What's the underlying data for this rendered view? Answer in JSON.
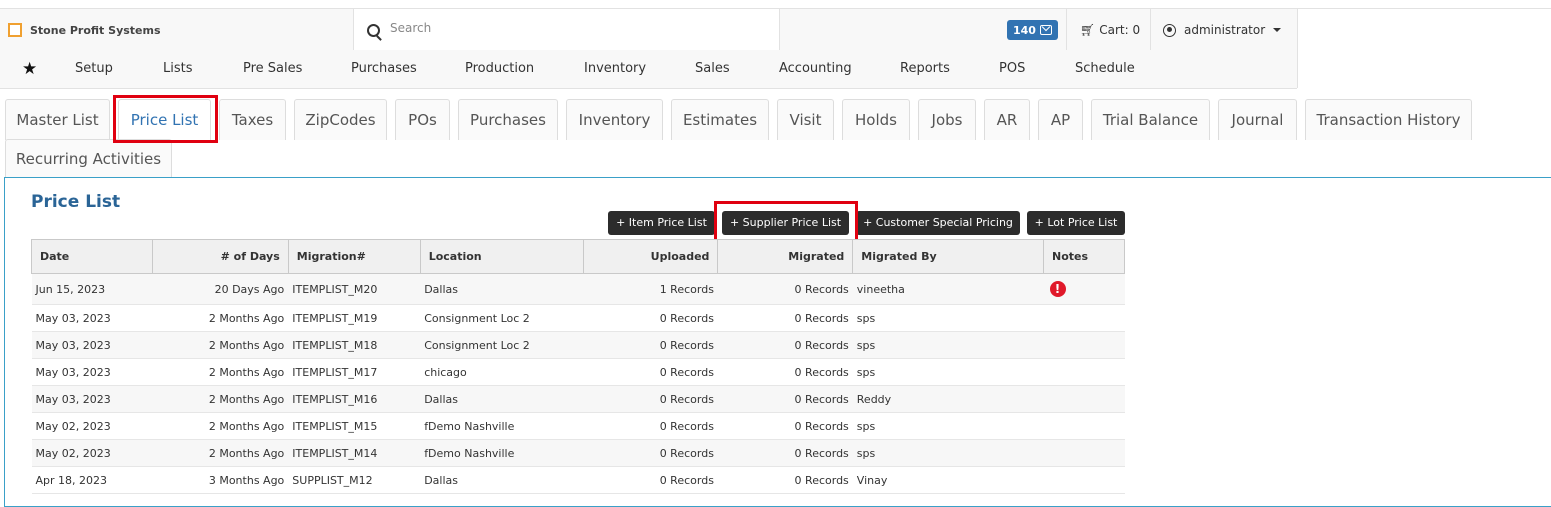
{
  "app": {
    "brand": "Stone Profit Systems",
    "search_placeholder": "Search",
    "notifications_count": "140",
    "cart_label": "Cart: 0",
    "user_name": "administrator"
  },
  "menu": [
    "Setup",
    "Lists",
    "Pre Sales",
    "Purchases",
    "Production",
    "Inventory",
    "Sales",
    "Accounting",
    "Reports",
    "POS",
    "Schedule"
  ],
  "tabs": [
    "Master List",
    "Price List",
    "Taxes",
    "ZipCodes",
    "POs",
    "Purchases",
    "Inventory",
    "Estimates",
    "Visit",
    "Holds",
    "Jobs",
    "AR",
    "AP",
    "Trial Balance",
    "Journal",
    "Transaction History",
    "Recurring Activities"
  ],
  "active_tab": "Price List",
  "page": {
    "title": "Price List",
    "buttons": [
      "+ Item Price List",
      "+ Supplier Price List",
      "+ Customer Special Pricing",
      "+ Lot Price List"
    ]
  },
  "table": {
    "headers": [
      "Date",
      "# of Days",
      "Migration#",
      "Location",
      "Uploaded",
      "Migrated",
      "Migrated By",
      "Notes"
    ],
    "rows": [
      [
        "Jun 15, 2023",
        "20 Days Ago",
        "ITEMPLIST_M20",
        "Dallas",
        "1 Records",
        "0 Records",
        "vineetha",
        "!"
      ],
      [
        "May 03, 2023",
        "2 Months Ago",
        "ITEMPLIST_M19",
        "Consignment Loc 2",
        "0 Records",
        "0 Records",
        "sps",
        ""
      ],
      [
        "May 03, 2023",
        "2 Months Ago",
        "ITEMPLIST_M18",
        "Consignment Loc 2",
        "0 Records",
        "0 Records",
        "sps",
        ""
      ],
      [
        "May 03, 2023",
        "2 Months Ago",
        "ITEMPLIST_M17",
        "chicago",
        "0 Records",
        "0 Records",
        "sps",
        ""
      ],
      [
        "May 03, 2023",
        "2 Months Ago",
        "ITEMPLIST_M16",
        "Dallas",
        "0 Records",
        "0 Records",
        "Reddy",
        ""
      ],
      [
        "May 02, 2023",
        "2 Months Ago",
        "ITEMPLIST_M15",
        "fDemo Nashville",
        "0 Records",
        "0 Records",
        "sps",
        ""
      ],
      [
        "May 02, 2023",
        "2 Months Ago",
        "ITEMPLIST_M14",
        "fDemo Nashville",
        "0 Records",
        "0 Records",
        "sps",
        ""
      ],
      [
        "Apr 18, 2023",
        "3 Months Ago",
        "SUPPLIST_M12",
        "Dallas",
        "0 Records",
        "0 Records",
        "Vinay",
        ""
      ]
    ]
  },
  "colors": {
    "accent": "#3173b2",
    "highlight": "#e00010",
    "alert": "#e0192a",
    "button_dark": "#2c2c2c"
  }
}
